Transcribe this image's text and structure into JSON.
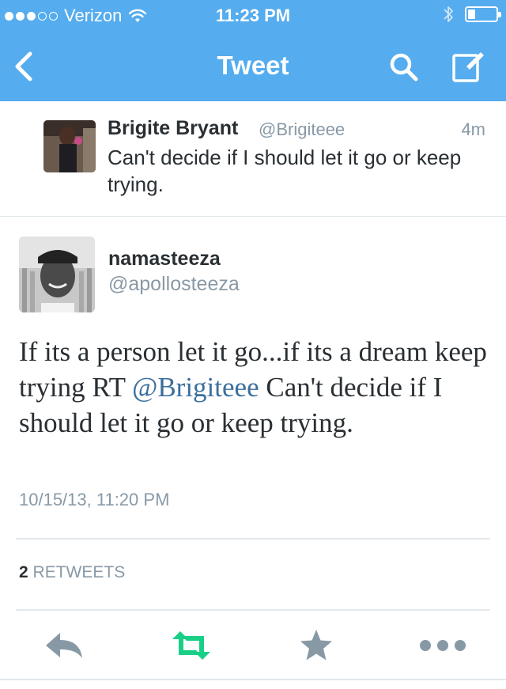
{
  "status_bar": {
    "carrier": "Verizon",
    "time": "11:23 PM",
    "signal_dots_full": 3,
    "signal_dots_total": 5,
    "battery_level": 0.25
  },
  "nav": {
    "title": "Tweet",
    "back_icon": "chevron-left-icon",
    "search_icon": "search-icon",
    "compose_icon": "compose-icon"
  },
  "original_tweet": {
    "name": "Brigite Bryant",
    "handle": "@Brigiteee",
    "time": "4m",
    "text": "Can't decide if I should let it go or keep trying."
  },
  "reply_tweet": {
    "name": "namasteeza",
    "handle": "@apollosteeza",
    "text_before": "If its a person let it go...if its a dream keep trying RT ",
    "mention": "@Brigiteee",
    "text_after": " Can't decide if I should let it go or keep trying.",
    "date": "10/15/13, 11:20 PM"
  },
  "stats": {
    "retweet_count": "2",
    "retweet_label": "RETWEETS"
  },
  "actions": {
    "reply_icon": "reply-icon",
    "retweet_icon": "retweet-icon",
    "favorite_icon": "star-icon",
    "more_icon": "more-icon"
  },
  "colors": {
    "brand_blue": "#55acee",
    "retweet_green": "#19cf86",
    "action_gray": "#8899a6",
    "mention_blue": "#3b6f9c"
  }
}
